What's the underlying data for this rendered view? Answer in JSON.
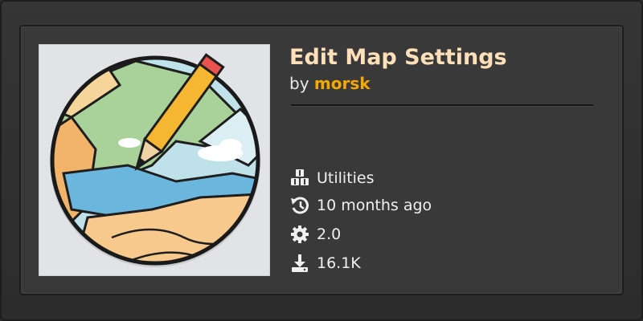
{
  "item": {
    "title": "Edit Map Settings",
    "by_label": "by",
    "author": "morsk"
  },
  "meta": {
    "category": {
      "icon": "cubes-icon",
      "text": "Utilities"
    },
    "updated": {
      "icon": "history-icon",
      "text": "10 months ago"
    },
    "version": {
      "icon": "gear-icon",
      "text": "2.0"
    },
    "downloads": {
      "icon": "download-icon",
      "text": "16.1K"
    }
  },
  "colors": {
    "title": "#ffe0b8",
    "author": "#f5a800",
    "text": "#f0f0f0",
    "card_bg": "#393939"
  }
}
